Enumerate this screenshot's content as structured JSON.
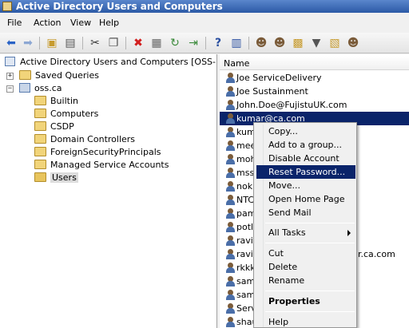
{
  "window": {
    "title": "Active Directory Users and Computers"
  },
  "menu": [
    "File",
    "Action",
    "View",
    "Help"
  ],
  "toolbar_icons": [
    "back-icon",
    "forward-icon",
    "up-folder-icon",
    "show-hide-tree-icon",
    "cut-icon",
    "copy-icon",
    "delete-icon",
    "properties-icon",
    "refresh-icon",
    "export-icon",
    "help-icon",
    "console-icon",
    "new-user-icon",
    "new-group-icon",
    "new-ou-icon",
    "filter-icon",
    "find-icon",
    "add-to-group-icon"
  ],
  "tree": {
    "root": "Active Directory Users and Computers [OSS-DC.os",
    "saved_queries": "Saved Queries",
    "domain": "oss.ca",
    "children": [
      "Builtin",
      "Computers",
      "CSDP",
      "Domain Controllers",
      "ForeignSecurityPrincipals",
      "Managed Service Accounts",
      "Users"
    ]
  },
  "list": {
    "column_header": "Name",
    "rows": [
      "Joe ServiceDelivery",
      "Joe Sustainment",
      "John.Doe@FujistuUK.com",
      "kumar@ca.com",
      "kum",
      "mee",
      "moh",
      "mss",
      "noki",
      "NTC",
      "pam",
      "potl",
      "ravi",
      "ravik",
      "rkkk",
      "samp",
      "sam",
      "Serv",
      "shau"
    ],
    "selected_index": 3,
    "overflow_tail": "r.ca.com"
  },
  "context_menu": {
    "group1": [
      "Copy...",
      "Add to a group...",
      "Disable Account",
      "Reset Password...",
      "Move...",
      "Open Home Page",
      "Send Mail"
    ],
    "highlighted": "Reset Password...",
    "all_tasks": "All Tasks",
    "group3": [
      "Cut",
      "Delete",
      "Rename"
    ],
    "properties": "Properties",
    "help": "Help"
  },
  "colors": {
    "selection": "#0a246a",
    "titlebar": "#2c5aa6",
    "folder": "#f1d47a"
  }
}
